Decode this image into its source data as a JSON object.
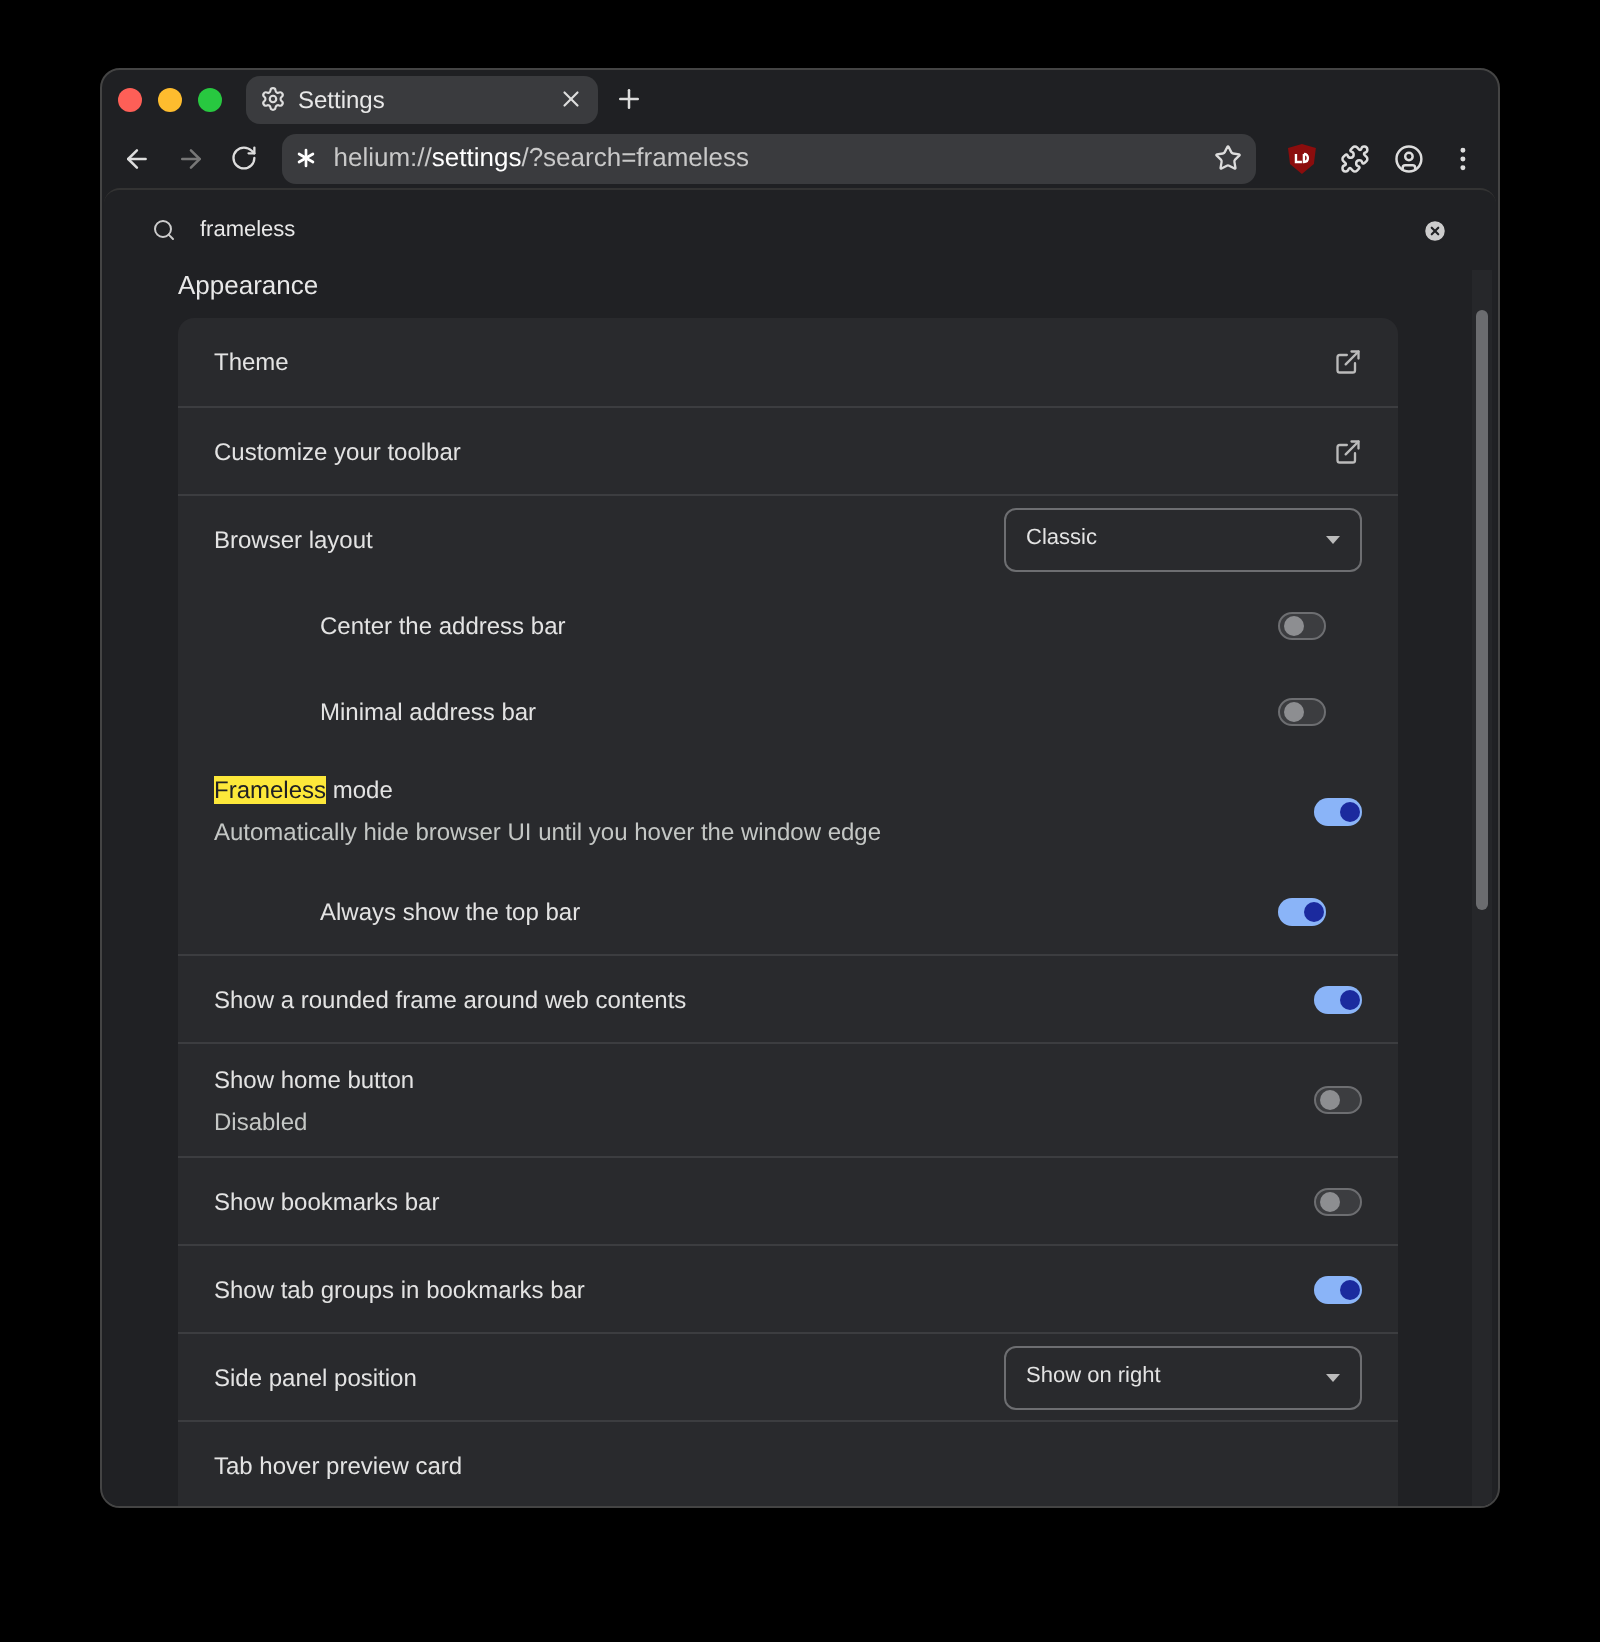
{
  "tab": {
    "title": "Settings",
    "selected": true
  },
  "address": {
    "scheme": "helium://",
    "host": "settings",
    "path": "/?search=frameless"
  },
  "search": {
    "value": "frameless"
  },
  "section": {
    "title": "Appearance"
  },
  "rows": [
    {
      "kind": "link",
      "label": "Theme"
    },
    {
      "kind": "link",
      "label": "Customize your toolbar"
    },
    {
      "kind": "select",
      "label": "Browser layout",
      "value": "Classic"
    },
    {
      "kind": "subtoggle",
      "label": "Center the address bar",
      "on": false
    },
    {
      "kind": "subtoggle",
      "label": "Minimal address bar",
      "on": false
    },
    {
      "kind": "toggle",
      "highlight": "Frameless",
      "label": " mode",
      "sublabel": "Automatically hide browser UI until you hover the window edge",
      "on": true,
      "divider": false
    },
    {
      "kind": "subtoggle",
      "label": "Always show the top bar",
      "on": true
    },
    {
      "kind": "toggle",
      "label": "Show a rounded frame around web contents",
      "on": true
    },
    {
      "kind": "toggle",
      "label": "Show home button",
      "sublabel": "Disabled",
      "on": false
    },
    {
      "kind": "toggle",
      "label": "Show bookmarks bar",
      "on": false
    },
    {
      "kind": "toggle",
      "label": "Show tab groups in bookmarks bar",
      "on": true
    },
    {
      "kind": "select",
      "label": "Side panel position",
      "value": "Show on right"
    },
    {
      "kind": "plain",
      "label": "Tab hover preview card"
    }
  ]
}
